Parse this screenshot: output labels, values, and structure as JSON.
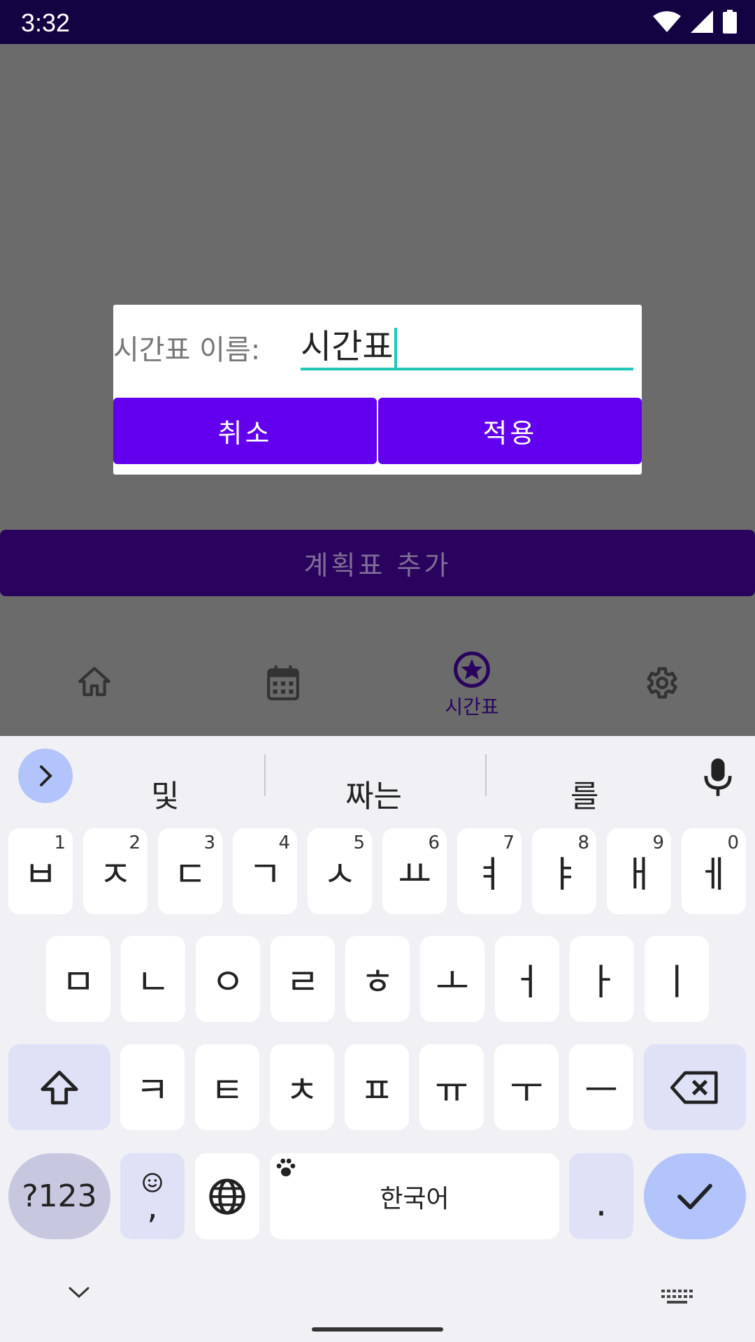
{
  "status_bar": {
    "time": "3:32"
  },
  "background": {
    "add_button_label": "계획표 추가",
    "nav": {
      "active_label": "시간표"
    }
  },
  "dialog": {
    "label": "시간표 이름:",
    "input_value": "시간표",
    "cancel_label": "취소",
    "apply_label": "적용"
  },
  "keyboard": {
    "suggestions": [
      "및",
      "짜는",
      "를"
    ],
    "row1": [
      {
        "key": "ㅂ",
        "hint": "1"
      },
      {
        "key": "ㅈ",
        "hint": "2"
      },
      {
        "key": "ㄷ",
        "hint": "3"
      },
      {
        "key": "ㄱ",
        "hint": "4"
      },
      {
        "key": "ㅅ",
        "hint": "5"
      },
      {
        "key": "ㅛ",
        "hint": "6"
      },
      {
        "key": "ㅕ",
        "hint": "7"
      },
      {
        "key": "ㅑ",
        "hint": "8"
      },
      {
        "key": "ㅐ",
        "hint": "9"
      },
      {
        "key": "ㅔ",
        "hint": "0"
      }
    ],
    "row2": [
      "ㅁ",
      "ㄴ",
      "ㅇ",
      "ㄹ",
      "ㅎ",
      "ㅗ",
      "ㅓ",
      "ㅏ",
      "ㅣ"
    ],
    "row3": [
      "ㅋ",
      "ㅌ",
      "ㅊ",
      "ㅍ",
      "ㅠ",
      "ㅜ",
      "ㅡ"
    ],
    "symbols_label": "?123",
    "comma_label": ",",
    "space_label": "한국어",
    "period_label": "."
  },
  "colors": {
    "accent": "#6200ee",
    "input_underline": "#21c7b8",
    "status_bar": "#140342"
  }
}
